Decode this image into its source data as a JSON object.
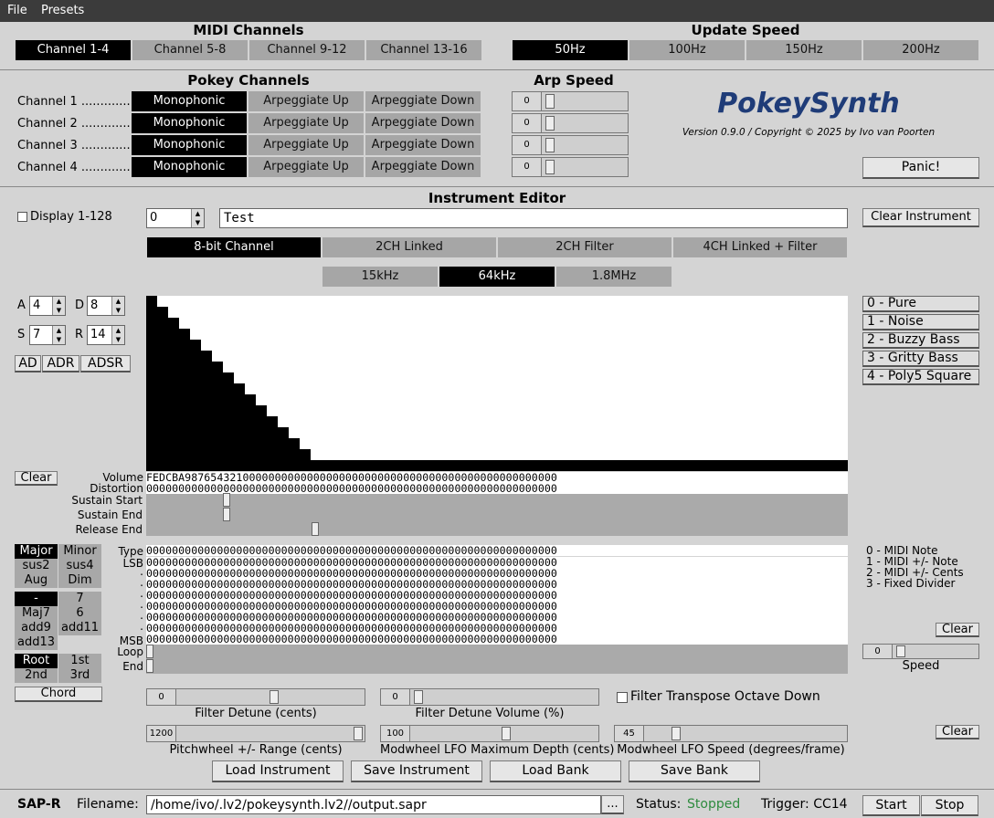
{
  "menu": {
    "file": "File",
    "presets": "Presets"
  },
  "midi": {
    "title": "MIDI Channels",
    "tabs": [
      "Channel 1-4",
      "Channel 5-8",
      "Channel 9-12",
      "Channel 13-16"
    ],
    "active": 0
  },
  "update": {
    "title": "Update Speed",
    "tabs": [
      "50Hz",
      "100Hz",
      "150Hz",
      "200Hz"
    ],
    "active": 0
  },
  "pokey": {
    "title": "Pokey Channels",
    "channels": [
      "Channel 1 .............",
      "Channel 2 .............",
      "Channel 3 .............",
      "Channel 4 ............."
    ],
    "modes": [
      "Monophonic",
      "Arpeggiate Up",
      "Arpeggiate Down"
    ]
  },
  "arp": {
    "title": "Arp Speed",
    "values": [
      "0",
      "0",
      "0",
      "0"
    ]
  },
  "brand": {
    "name": "PokeySynth",
    "version": "Version 0.9.0 / Copyright © 2025 by Ivo van Poorten"
  },
  "panic": "Panic!",
  "editor": {
    "title": "Instrument Editor",
    "display_label": "Display 1-128",
    "number": "0",
    "name": "Test",
    "clear_instrument": "Clear Instrument",
    "modes": [
      "8-bit Channel",
      "2CH Linked",
      "2CH Filter",
      "4CH Linked + Filter"
    ],
    "clocks": [
      "15kHz",
      "64kHz",
      "1.8MHz"
    ],
    "adsr": {
      "a_label": "A",
      "a": "4",
      "d_label": "D",
      "d": "8",
      "s_label": "S",
      "s": "7",
      "r_label": "R",
      "r": "14"
    },
    "env_buttons": [
      "AD",
      "ADR",
      "ADSR"
    ],
    "waves": [
      "0 - Pure",
      "1 - Noise",
      "2 - Buzzy Bass",
      "3 - Gritty Bass",
      "4 - Poly5 Square"
    ],
    "clear": "Clear",
    "rows": {
      "volume": "Volume",
      "distortion": "Distortion",
      "sustain_start": "Sustain Start",
      "sustain_end": "Sustain End",
      "release_end": "Release End"
    },
    "volume_seq": "FEDCBA9876543210000000000000000000000000000000000000000000000000",
    "distortion_seq": "0000000000000000000000000000000000000000000000000000000000000000",
    "note_rows": {
      "type": "Type",
      "lsb": "LSB",
      "msb": "MSB",
      "loop": "Loop",
      "end": "End",
      "dot": "."
    },
    "zero_seq": "0000000000000000000000000000000000000000000000000000000000000000",
    "type_legend": [
      "0 - MIDI Note",
      "1 - MIDI +/- Note",
      "2 - MIDI +/- Cents",
      "3 - Fixed Divider"
    ],
    "speed_label": "Speed",
    "speed_value": "0",
    "chords": {
      "row1": [
        "Major",
        "Minor"
      ],
      "row2": [
        "sus2",
        "sus4"
      ],
      "row3": [
        "Aug",
        "Dim"
      ],
      "row4": [
        "-",
        "7"
      ],
      "row5": [
        "Maj7",
        "6"
      ],
      "row6": [
        "add9",
        "add11"
      ],
      "row7": [
        "add13",
        ""
      ],
      "row8": [
        "Root",
        "1st"
      ],
      "row9": [
        "2nd",
        "3rd"
      ],
      "chord_btn": "Chord"
    },
    "filter_detune": {
      "label": "Filter Detune (cents)",
      "value": "0"
    },
    "filter_detune_vol": {
      "label": "Filter Detune Volume (%)",
      "value": "0"
    },
    "filter_transpose": "Filter Transpose Octave Down",
    "pitchwheel": {
      "label": "Pitchwheel +/- Range (cents)",
      "value": "1200"
    },
    "modwheel_depth": {
      "label": "Modwheel LFO Maximum Depth (cents)",
      "value": "100"
    },
    "modwheel_speed": {
      "label": "Modwheel LFO Speed (degrees/frame)",
      "value": "45"
    },
    "load_instrument": "Load Instrument",
    "save_instrument": "Save Instrument",
    "load_bank": "Load Bank",
    "save_bank": "Save Bank"
  },
  "footer": {
    "sapr": "SAP-R",
    "filename_label": "Filename:",
    "filename": "/home/ivo/.lv2/pokeysynth.lv2//output.sapr",
    "browse": "...",
    "status_label": "Status:",
    "status": "Stopped",
    "trigger": "Trigger: CC14",
    "start": "Start",
    "stop": "Stop"
  },
  "colors": {
    "brand": "#1f3c78",
    "status": "#2e8b3e",
    "active_bg": "#000000",
    "inactive_bg": "#a6a6a6"
  },
  "envelope_levels": [
    15,
    14,
    13,
    12,
    11,
    10,
    9,
    8,
    7,
    6,
    5,
    4,
    3,
    2,
    1,
    0
  ]
}
